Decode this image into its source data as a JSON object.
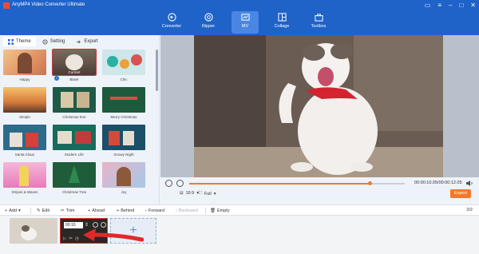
{
  "app": {
    "title": "AnyMP4 Video Converter Ultimate"
  },
  "window_controls": [
    "chat-icon",
    "menu-icon",
    "minimize-icon",
    "maximize-icon",
    "close-icon"
  ],
  "nav": [
    {
      "label": "Converter",
      "icon": "converter-icon",
      "active": false
    },
    {
      "label": "Ripper",
      "icon": "ripper-icon",
      "active": false
    },
    {
      "label": "MV",
      "icon": "mv-icon",
      "active": true
    },
    {
      "label": "Collage",
      "icon": "collage-icon",
      "active": false
    },
    {
      "label": "Toolbox",
      "icon": "toolbox-icon",
      "active": false
    }
  ],
  "left_tabs": [
    {
      "label": "Theme",
      "icon": "grid-icon",
      "active": true
    },
    {
      "label": "Setting",
      "icon": "gear-icon",
      "active": false
    },
    {
      "label": "Export",
      "icon": "export-icon",
      "active": false
    }
  ],
  "themes": [
    {
      "name": "Happy",
      "badge": "",
      "selected": false
    },
    {
      "name": "Blank",
      "badge": "Current",
      "selected": true
    },
    {
      "name": "Chic",
      "badge": "",
      "selected": false
    },
    {
      "name": "Simple",
      "badge": "",
      "selected": false
    },
    {
      "name": "Christmas Eve",
      "badge": "",
      "selected": false
    },
    {
      "name": "Merry Christmas",
      "badge": "",
      "selected": false
    },
    {
      "name": "Santa Claus",
      "badge": "",
      "selected": false
    },
    {
      "name": "Modern Life",
      "badge": "",
      "selected": false
    },
    {
      "name": "Snowy Night",
      "badge": "",
      "selected": false
    },
    {
      "name": "Stripes & Waves",
      "badge": "",
      "selected": false
    },
    {
      "name": "Christmas Tree",
      "badge": "",
      "selected": false
    },
    {
      "name": "Joy",
      "badge": "",
      "selected": false
    }
  ],
  "player": {
    "time": "00:00:10.05/00:00:12.05",
    "progress": 0.84,
    "aspect": "16:9",
    "mode": "Full",
    "export_label": "Export"
  },
  "toolbar": {
    "add": "Add",
    "edit": "Edit",
    "trim": "Trim",
    "ahead": "Ahead",
    "behind": "Behind",
    "forward": "Forward",
    "backward": "Backward",
    "empty": "Empty",
    "pages": "2/2"
  },
  "timeline": {
    "clip_duration": "00:10",
    "add_slot": "+"
  },
  "colors": {
    "brand": "#1f63c9",
    "accent": "#f07a2a",
    "highlight": "#e02a2a"
  }
}
